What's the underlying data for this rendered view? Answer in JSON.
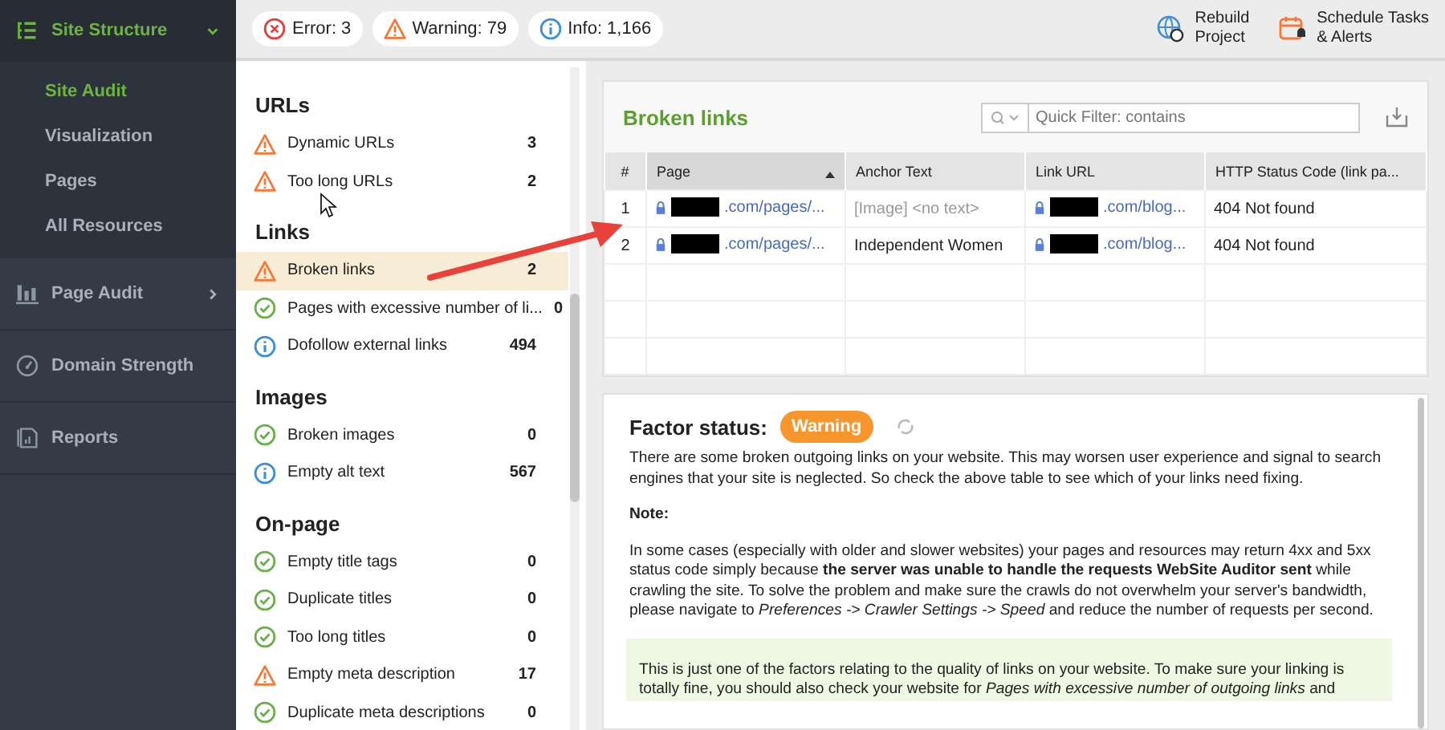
{
  "sidebar": {
    "sections": [
      {
        "kind": "structure",
        "label": "Site Structure",
        "expanded": true,
        "selected": true,
        "children": [
          {
            "label": "Site Audit",
            "selected": true
          },
          {
            "label": "Visualization",
            "selected": false
          },
          {
            "label": "Pages",
            "selected": false
          },
          {
            "label": "All Resources",
            "selected": false
          }
        ]
      },
      {
        "kind": "audit",
        "label": "Page Audit",
        "expanded": false,
        "selected": false
      },
      {
        "kind": "gauge",
        "label": "Domain Strength",
        "selected": false
      },
      {
        "kind": "report",
        "label": "Reports",
        "selected": false
      }
    ]
  },
  "top_bar": {
    "badges": [
      {
        "kind": "error",
        "label": "Error: 3"
      },
      {
        "kind": "warning",
        "label": "Warning: 79"
      },
      {
        "kind": "info",
        "label": "Info: 1,166"
      }
    ],
    "actions": [
      {
        "kind": "rebuild",
        "lines": [
          "Rebuild",
          "Project"
        ]
      },
      {
        "kind": "schedule",
        "lines": [
          "Schedule Tasks",
          "& Alerts"
        ]
      }
    ]
  },
  "issues": [
    {
      "title": "URLs",
      "items": [
        {
          "kind": "warning",
          "label": "Dynamic URLs",
          "count": "3",
          "selected": false
        },
        {
          "kind": "warning",
          "label": "Too long URLs",
          "count": "2",
          "selected": false
        }
      ]
    },
    {
      "title": "Links",
      "items": [
        {
          "kind": "warning",
          "label": "Broken links",
          "count": "2",
          "selected": true
        },
        {
          "kind": "ok",
          "label": "Pages with excessive number of li...",
          "count": "0",
          "selected": false
        },
        {
          "kind": "info",
          "label": "Dofollow external links",
          "count": "494",
          "selected": false
        }
      ]
    },
    {
      "title": "Images",
      "items": [
        {
          "kind": "ok",
          "label": "Broken images",
          "count": "0",
          "selected": false
        },
        {
          "kind": "info",
          "label": "Empty alt text",
          "count": "567",
          "selected": false
        }
      ]
    },
    {
      "title": "On-page",
      "items": [
        {
          "kind": "ok",
          "label": "Empty title tags",
          "count": "0",
          "selected": false
        },
        {
          "kind": "ok",
          "label": "Duplicate titles",
          "count": "0",
          "selected": false
        },
        {
          "kind": "ok",
          "label": "Too long titles",
          "count": "0",
          "selected": false
        },
        {
          "kind": "warning",
          "label": "Empty meta description",
          "count": "17",
          "selected": false
        },
        {
          "kind": "ok",
          "label": "Duplicate meta descriptions",
          "count": "0",
          "selected": false
        }
      ]
    }
  ],
  "report": {
    "title": "Broken links",
    "filter": {
      "placeholder": "Quick Filter: contains"
    },
    "table": {
      "columns": [
        {
          "label": "#",
          "sorted": false
        },
        {
          "label": "Page",
          "sorted": true
        },
        {
          "label": "Anchor Text",
          "sorted": false
        },
        {
          "label": "Link URL",
          "sorted": false
        },
        {
          "label": "HTTP Status Code (link pa...",
          "sorted": false
        }
      ],
      "rows": [
        {
          "index": "1",
          "page": ".com/pages/...",
          "anchor": "[Image] <no text>",
          "anchor_muted": true,
          "link": ".com/blog...",
          "status": "404 Not found"
        },
        {
          "index": "2",
          "page": ".com/pages/...",
          "anchor": "Independent Women",
          "anchor_muted": false,
          "link": ".com/blog...",
          "status": "404 Not found"
        }
      ]
    }
  },
  "factor": {
    "label": "Factor status:",
    "status": "Warning",
    "paragraphs": [
      {
        "kind": "text",
        "text": "There are some broken outgoing links on your website. This may worsen user experience and signal to search engines that your site is neglected. So check the above table to see which of your links need fixing."
      },
      {
        "kind": "heading",
        "text": "Note:"
      },
      {
        "kind": "text",
        "text": "In some cases (especially with older and slower websites) your pages and resources may return 4xx and 5xx status code simply because **the server was unable to handle the requests WebSite Auditor sent** while crawling the site. To solve the problem and make sure the crawls do not overwhelm your server's bandwidth, please navigate to *Preferences -> Crawler Settings -> Speed* and reduce the number of requests per second."
      },
      {
        "kind": "tip",
        "text": "This is just one of the factors relating to the quality of links on your website. To make sure your linking is totally fine, you should also check your website for *Pages with excessive number of outgoing links* and"
      }
    ]
  }
}
